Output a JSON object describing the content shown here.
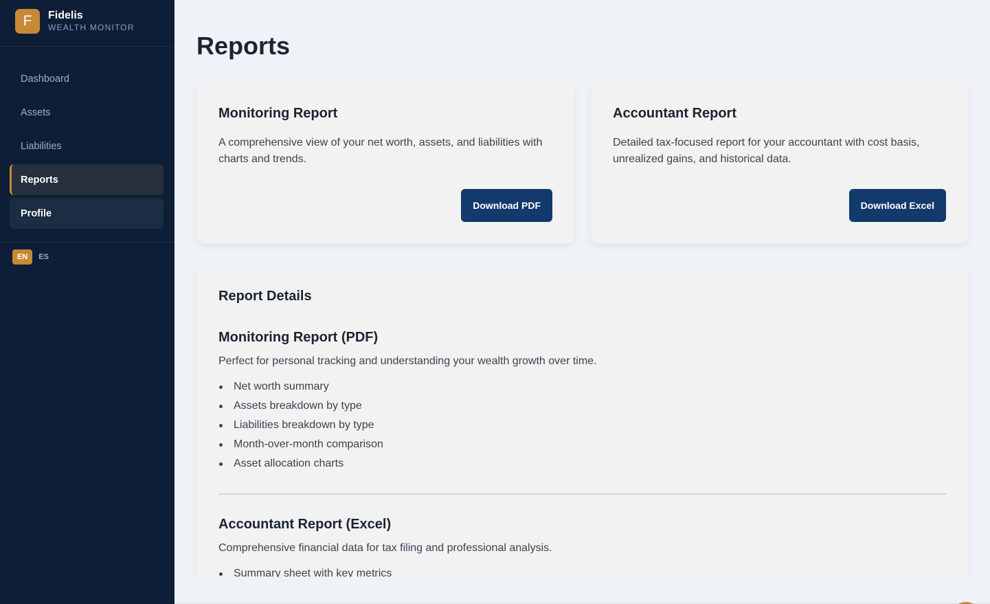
{
  "brand": {
    "logo_letter": "F",
    "name": "Fidelis",
    "subtitle": "WEALTH MONITOR"
  },
  "nav": {
    "items": [
      {
        "label": "Dashboard"
      },
      {
        "label": "Assets"
      },
      {
        "label": "Liabilities"
      },
      {
        "label": "Reports",
        "active": true
      },
      {
        "label": "Profile"
      }
    ]
  },
  "languages": [
    {
      "code": "EN",
      "active": true
    },
    {
      "code": "ES",
      "active": false
    }
  ],
  "page": {
    "title": "Reports"
  },
  "cards": {
    "monitoring": {
      "title": "Monitoring Report",
      "description": "A comprehensive view of your net worth, assets, and liabilities with charts and trends.",
      "button_label": "Download PDF"
    },
    "accountant": {
      "title": "Accountant Report",
      "description": "Detailed tax-focused report for your accountant with cost basis, unrealized gains, and historical data.",
      "button_label": "Download Excel"
    }
  },
  "details": {
    "title": "Report Details",
    "monitoring": {
      "title": "Monitoring Report (PDF)",
      "description": "Perfect for personal tracking and understanding your wealth growth over time.",
      "features": [
        "Net worth summary",
        "Assets breakdown by type",
        "Liabilities breakdown by type",
        "Month-over-month comparison",
        "Asset allocation charts"
      ]
    },
    "accountant": {
      "title": "Accountant Report (Excel)",
      "description": "Comprehensive financial data for tax filing and professional analysis.",
      "features": [
        "Summary sheet with key metrics"
      ]
    }
  },
  "colors": {
    "sidebar_bg": "#0e1e36",
    "accent": "#c68a35",
    "button_bg": "#123a6b",
    "page_bg": "#eff3f7"
  }
}
